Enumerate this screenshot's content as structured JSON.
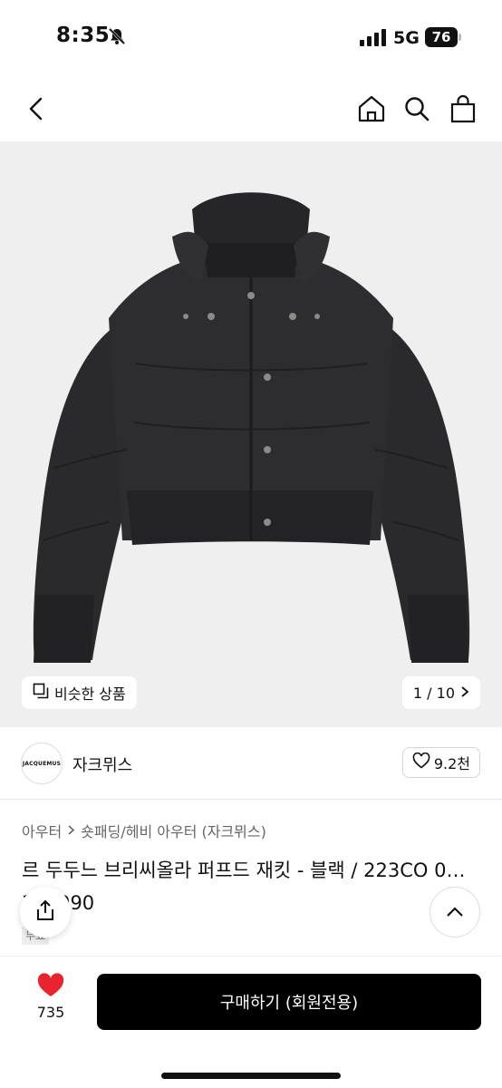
{
  "status_bar": {
    "time": "8:35",
    "network": "5G",
    "battery": "76"
  },
  "nav": {
    "back_icon": "chevron-left-icon",
    "home_icon": "home-icon",
    "search_icon": "search-icon",
    "bag_icon": "shopping-bag-icon"
  },
  "gallery": {
    "similar_label": "비슷한 상품",
    "counter": "1 / 10",
    "image_subject": "black cropped puffer jacket"
  },
  "brand": {
    "logo_text": "JACQUEMUS",
    "name": "자크뮈스",
    "like_count": "9.2천"
  },
  "product": {
    "breadcrumb": [
      "아우터",
      "숏패딩/헤비 아우터 (자크뮈스)"
    ],
    "title": "르 두두느 브리씨올라 퍼프드 재킷 - 블랙 / 223CO 0…320990",
    "badge": "무료"
  },
  "bottom_bar": {
    "wish_count": "735",
    "buy_label": "구매하기 (회원전용)"
  },
  "colors": {
    "accent_heart": "#e8242e",
    "buy_button": "#000000",
    "hero_bg": "#efefef"
  }
}
